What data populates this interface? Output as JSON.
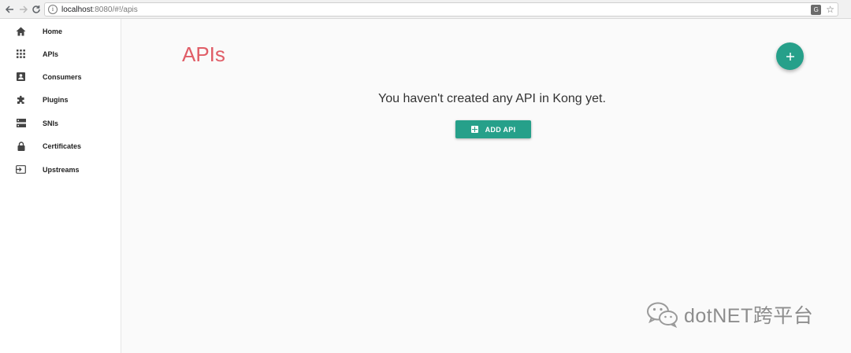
{
  "browser": {
    "url_host": "localhost",
    "url_path": ":8080/#!/apis"
  },
  "sidebar": {
    "items": [
      {
        "label": "Home",
        "icon": "home-icon"
      },
      {
        "label": "APIs",
        "icon": "grid-icon"
      },
      {
        "label": "Consumers",
        "icon": "account-box-icon"
      },
      {
        "label": "Plugins",
        "icon": "puzzle-icon"
      },
      {
        "label": "SNIs",
        "icon": "dns-icon"
      },
      {
        "label": "Certificates",
        "icon": "lock-icon"
      },
      {
        "label": "Upstreams",
        "icon": "input-icon"
      }
    ]
  },
  "main": {
    "title": "APIs",
    "empty_message": "You haven't created any API in Kong yet.",
    "add_button_label": "ADD API",
    "fab_label": "+"
  },
  "watermark": {
    "text": "dotNET跨平台"
  },
  "colors": {
    "accent": "#26a08a",
    "title": "#e05d67"
  }
}
